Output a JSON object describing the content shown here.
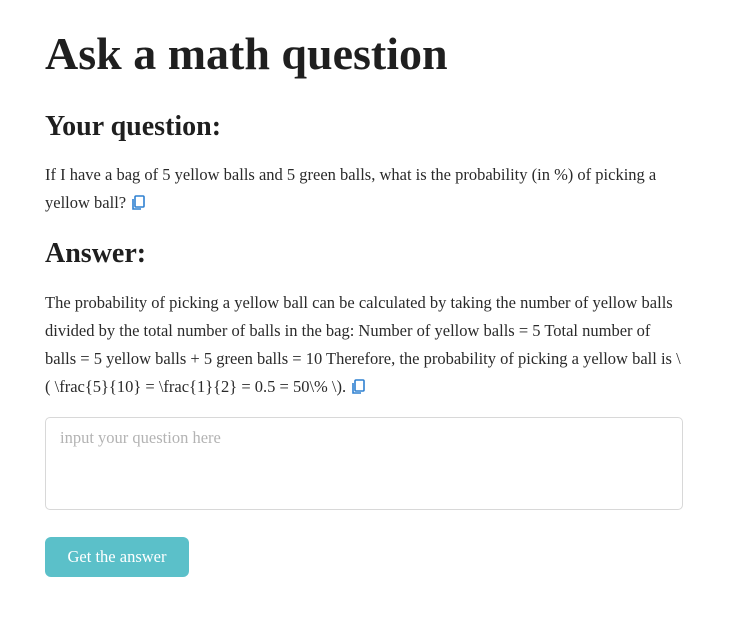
{
  "page": {
    "title": "Ask a math question"
  },
  "question_section": {
    "heading": "Your question:",
    "text": "If I have a bag of 5 yellow balls and 5 green balls, what is the probability (in %) of picking a yellow ball?",
    "copy_icon": "copy-icon"
  },
  "answer_section": {
    "heading": "Answer:",
    "text": "The probability of picking a yellow ball can be calculated by taking the number of yellow balls divided by the total number of balls in the bag: Number of yellow balls = 5 Total number of balls = 5 yellow balls + 5 green balls = 10 Therefore, the probability of picking a yellow ball is \\( \\frac{5}{10} = \\frac{1}{2} = 0.5 = 50\\% \\).",
    "copy_icon": "copy-icon"
  },
  "question_input": {
    "value": "",
    "placeholder": "input your question here"
  },
  "submit": {
    "label": "Get the answer"
  },
  "colors": {
    "accent": "#5bc0c9",
    "icon": "#2f80d1"
  }
}
